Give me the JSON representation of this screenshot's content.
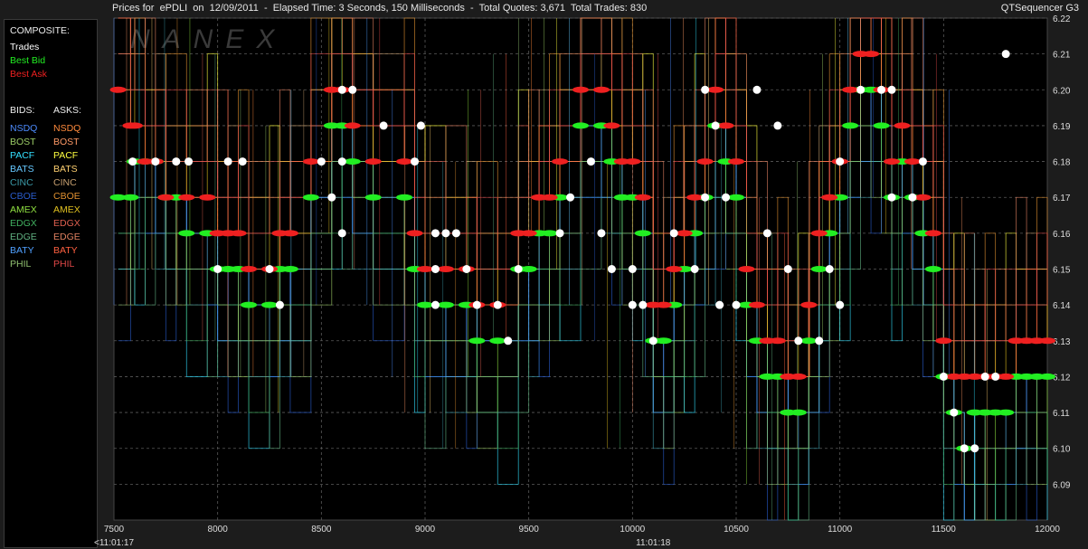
{
  "header": {
    "title": "Prices for  ePDLI  on  12/09/2011  -  Elapsed Time: 3 Seconds, 150 Milliseconds  -  Total Quotes: 3,671  Total Trades: 830",
    "app": "QTSequencer G3"
  },
  "watermark": "NANEX",
  "legend": {
    "composite_header": "COMPOSITE:",
    "composite": [
      {
        "label": "Trades",
        "color": "#ffffff"
      },
      {
        "label": "Best Bid",
        "color": "#22ee22"
      },
      {
        "label": "Best Ask",
        "color": "#ee2020"
      }
    ],
    "bids_header": "BIDS:",
    "asks_header": "ASKS:",
    "exchanges": [
      {
        "name": "NSDQ",
        "bid_color": "#4d8cff",
        "ask_color": "#ff8a3c"
      },
      {
        "name": "BOST",
        "bid_color": "#9ccc66",
        "ask_color": "#ff9966"
      },
      {
        "name": "PACF",
        "bid_color": "#33e0ff",
        "ask_color": "#ffff40"
      },
      {
        "name": "BATS",
        "bid_color": "#66c8ff",
        "ask_color": "#ffd070"
      },
      {
        "name": "CINC",
        "bid_color": "#3b9aa8",
        "ask_color": "#c8a070"
      },
      {
        "name": "CBOE",
        "bid_color": "#2a5ccc",
        "ask_color": "#e09030"
      },
      {
        "name": "AMEX",
        "bid_color": "#8fe040",
        "ask_color": "#e0c020"
      },
      {
        "name": "EDGX",
        "bid_color": "#40b060",
        "ask_color": "#e06050"
      },
      {
        "name": "EDGE",
        "bid_color": "#60b080",
        "ask_color": "#e08060"
      },
      {
        "name": "BATY",
        "bid_color": "#50a0ff",
        "ask_color": "#ff6040"
      },
      {
        "name": "PHIL",
        "bid_color": "#90c070",
        "ask_color": "#e04848"
      }
    ]
  },
  "chart_data": {
    "type": "line",
    "title": "",
    "xlabel": "",
    "ylabel": "",
    "xlim": [
      7500,
      12000
    ],
    "ylim": [
      6.08,
      6.22
    ],
    "x_ticks": [
      7500,
      8000,
      8500,
      9000,
      9500,
      10000,
      10500,
      11000,
      11500,
      12000
    ],
    "y_ticks": [
      6.09,
      6.1,
      6.11,
      6.12,
      6.13,
      6.14,
      6.15,
      6.16,
      6.17,
      6.18,
      6.19,
      6.2,
      6.21,
      6.22
    ],
    "time_labels": [
      {
        "x": 7500,
        "label": "<11:01:17"
      },
      {
        "x": 10100,
        "label": "11:01:18"
      }
    ],
    "grid": true,
    "series": [
      {
        "name": "Best Bid",
        "color": "#22ee22",
        "points": [
          [
            7520,
            6.17
          ],
          [
            7580,
            6.17
          ],
          [
            7600,
            6.18
          ],
          [
            7650,
            6.18
          ],
          [
            7700,
            6.18
          ],
          [
            7750,
            6.17
          ],
          [
            7800,
            6.17
          ],
          [
            7850,
            6.16
          ],
          [
            7950,
            6.16
          ],
          [
            8000,
            6.15
          ],
          [
            8050,
            6.15
          ],
          [
            8100,
            6.15
          ],
          [
            8150,
            6.14
          ],
          [
            8250,
            6.14
          ],
          [
            8300,
            6.15
          ],
          [
            8350,
            6.15
          ],
          [
            8450,
            6.17
          ],
          [
            8550,
            6.19
          ],
          [
            8600,
            6.19
          ],
          [
            8650,
            6.18
          ],
          [
            8750,
            6.17
          ],
          [
            8900,
            6.17
          ],
          [
            8950,
            6.15
          ],
          [
            9000,
            6.14
          ],
          [
            9100,
            6.14
          ],
          [
            9200,
            6.14
          ],
          [
            9250,
            6.13
          ],
          [
            9350,
            6.13
          ],
          [
            9450,
            6.15
          ],
          [
            9500,
            6.15
          ],
          [
            9550,
            6.16
          ],
          [
            9600,
            6.16
          ],
          [
            9650,
            6.17
          ],
          [
            9750,
            6.19
          ],
          [
            9850,
            6.19
          ],
          [
            9900,
            6.18
          ],
          [
            9950,
            6.17
          ],
          [
            10000,
            6.17
          ],
          [
            10050,
            6.16
          ],
          [
            10100,
            6.13
          ],
          [
            10150,
            6.13
          ],
          [
            10200,
            6.14
          ],
          [
            10250,
            6.15
          ],
          [
            10300,
            6.16
          ],
          [
            10350,
            6.17
          ],
          [
            10400,
            6.19
          ],
          [
            10450,
            6.18
          ],
          [
            10500,
            6.17
          ],
          [
            10550,
            6.14
          ],
          [
            10600,
            6.13
          ],
          [
            10650,
            6.12
          ],
          [
            10700,
            6.12
          ],
          [
            10750,
            6.11
          ],
          [
            10800,
            6.11
          ],
          [
            10850,
            6.13
          ],
          [
            10900,
            6.15
          ],
          [
            10950,
            6.16
          ],
          [
            11000,
            6.17
          ],
          [
            11050,
            6.19
          ],
          [
            11100,
            6.2
          ],
          [
            11150,
            6.2
          ],
          [
            11200,
            6.19
          ],
          [
            11250,
            6.17
          ],
          [
            11300,
            6.18
          ],
          [
            11350,
            6.17
          ],
          [
            11400,
            6.16
          ],
          [
            11450,
            6.15
          ],
          [
            11500,
            6.12
          ],
          [
            11550,
            6.11
          ],
          [
            11600,
            6.1
          ],
          [
            11650,
            6.11
          ],
          [
            11700,
            6.11
          ],
          [
            11750,
            6.11
          ],
          [
            11800,
            6.11
          ],
          [
            11850,
            6.12
          ],
          [
            11900,
            6.12
          ],
          [
            11950,
            6.12
          ],
          [
            12000,
            6.12
          ]
        ]
      },
      {
        "name": "Best Ask",
        "color": "#ee2020",
        "points": [
          [
            7520,
            6.2
          ],
          [
            7580,
            6.19
          ],
          [
            7600,
            6.19
          ],
          [
            7650,
            6.18
          ],
          [
            7700,
            6.18
          ],
          [
            7750,
            6.17
          ],
          [
            7850,
            6.17
          ],
          [
            7950,
            6.17
          ],
          [
            8000,
            6.16
          ],
          [
            8050,
            6.16
          ],
          [
            8100,
            6.16
          ],
          [
            8150,
            6.15
          ],
          [
            8250,
            6.15
          ],
          [
            8300,
            6.16
          ],
          [
            8350,
            6.16
          ],
          [
            8450,
            6.18
          ],
          [
            8550,
            6.2
          ],
          [
            8600,
            6.2
          ],
          [
            8650,
            6.19
          ],
          [
            8750,
            6.18
          ],
          [
            8900,
            6.18
          ],
          [
            8950,
            6.16
          ],
          [
            9000,
            6.15
          ],
          [
            9100,
            6.15
          ],
          [
            9200,
            6.15
          ],
          [
            9250,
            6.14
          ],
          [
            9350,
            6.14
          ],
          [
            9450,
            6.16
          ],
          [
            9500,
            6.16
          ],
          [
            9550,
            6.17
          ],
          [
            9600,
            6.17
          ],
          [
            9650,
            6.18
          ],
          [
            9750,
            6.2
          ],
          [
            9850,
            6.2
          ],
          [
            9900,
            6.19
          ],
          [
            9950,
            6.18
          ],
          [
            10000,
            6.18
          ],
          [
            10050,
            6.17
          ],
          [
            10100,
            6.14
          ],
          [
            10150,
            6.14
          ],
          [
            10200,
            6.15
          ],
          [
            10250,
            6.16
          ],
          [
            10300,
            6.17
          ],
          [
            10350,
            6.18
          ],
          [
            10400,
            6.2
          ],
          [
            10450,
            6.19
          ],
          [
            10500,
            6.18
          ],
          [
            10550,
            6.15
          ],
          [
            10600,
            6.14
          ],
          [
            10650,
            6.13
          ],
          [
            10700,
            6.13
          ],
          [
            10750,
            6.12
          ],
          [
            10800,
            6.12
          ],
          [
            10850,
            6.14
          ],
          [
            10900,
            6.16
          ],
          [
            10950,
            6.17
          ],
          [
            11000,
            6.18
          ],
          [
            11050,
            6.2
          ],
          [
            11100,
            6.21
          ],
          [
            11150,
            6.21
          ],
          [
            11200,
            6.2
          ],
          [
            11250,
            6.18
          ],
          [
            11300,
            6.19
          ],
          [
            11350,
            6.18
          ],
          [
            11400,
            6.17
          ],
          [
            11450,
            6.16
          ],
          [
            11500,
            6.13
          ],
          [
            11550,
            6.12
          ],
          [
            11600,
            6.12
          ],
          [
            11650,
            6.12
          ],
          [
            11700,
            6.12
          ],
          [
            11750,
            6.12
          ],
          [
            11800,
            6.12
          ],
          [
            11850,
            6.13
          ],
          [
            11900,
            6.13
          ],
          [
            11950,
            6.13
          ],
          [
            12000,
            6.13
          ]
        ]
      },
      {
        "name": "Trades",
        "color": "#ffffff",
        "points": [
          [
            7590,
            6.18
          ],
          [
            7700,
            6.18
          ],
          [
            7800,
            6.18
          ],
          [
            7860,
            6.18
          ],
          [
            8050,
            6.18
          ],
          [
            8120,
            6.18
          ],
          [
            8000,
            6.15
          ],
          [
            8300,
            6.14
          ],
          [
            8250,
            6.15
          ],
          [
            8600,
            6.2
          ],
          [
            8650,
            6.2
          ],
          [
            8500,
            6.18
          ],
          [
            8600,
            6.18
          ],
          [
            8550,
            6.17
          ],
          [
            8600,
            6.16
          ],
          [
            8800,
            6.19
          ],
          [
            8980,
            6.19
          ],
          [
            8950,
            6.18
          ],
          [
            9100,
            6.16
          ],
          [
            9050,
            6.16
          ],
          [
            9150,
            6.16
          ],
          [
            9050,
            6.14
          ],
          [
            9050,
            6.15
          ],
          [
            9200,
            6.15
          ],
          [
            9250,
            6.14
          ],
          [
            9350,
            6.14
          ],
          [
            9400,
            6.13
          ],
          [
            9450,
            6.15
          ],
          [
            9650,
            6.16
          ],
          [
            9700,
            6.17
          ],
          [
            9800,
            6.18
          ],
          [
            9850,
            6.16
          ],
          [
            9900,
            6.15
          ],
          [
            10000,
            6.15
          ],
          [
            10000,
            6.14
          ],
          [
            10050,
            6.14
          ],
          [
            10100,
            6.13
          ],
          [
            10200,
            6.16
          ],
          [
            10300,
            6.15
          ],
          [
            10350,
            6.17
          ],
          [
            10400,
            6.19
          ],
          [
            10350,
            6.2
          ],
          [
            10420,
            6.14
          ],
          [
            10450,
            6.17
          ],
          [
            10500,
            6.14
          ],
          [
            10600,
            6.2
          ],
          [
            10650,
            6.16
          ],
          [
            10700,
            6.19
          ],
          [
            10750,
            6.15
          ],
          [
            10800,
            6.13
          ],
          [
            10900,
            6.13
          ],
          [
            10950,
            6.15
          ],
          [
            11000,
            6.14
          ],
          [
            11000,
            6.18
          ],
          [
            11100,
            6.2
          ],
          [
            11200,
            6.2
          ],
          [
            11250,
            6.2
          ],
          [
            11250,
            6.17
          ],
          [
            11350,
            6.17
          ],
          [
            11400,
            6.18
          ],
          [
            11500,
            6.12
          ],
          [
            11550,
            6.11
          ],
          [
            11600,
            6.1
          ],
          [
            11650,
            6.1
          ],
          [
            11700,
            6.12
          ],
          [
            11750,
            6.12
          ],
          [
            11800,
            6.21
          ]
        ]
      }
    ]
  }
}
